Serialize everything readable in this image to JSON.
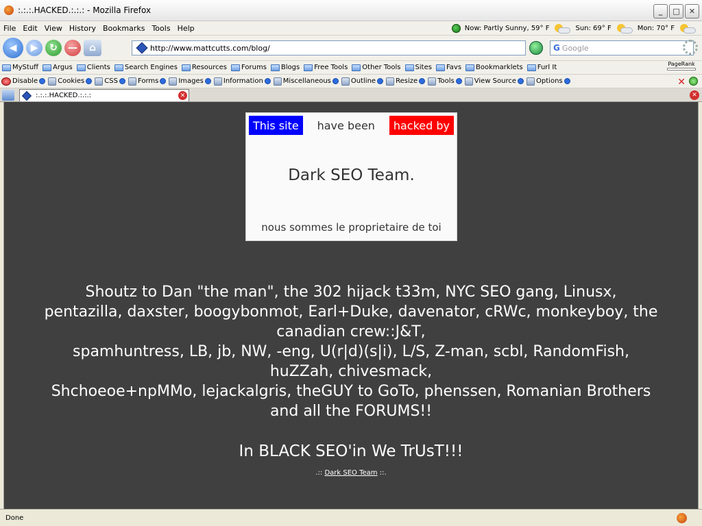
{
  "window": {
    "title": ":.:.:.HACKED.:.:.: - Mozilla Firefox"
  },
  "menu": [
    "File",
    "Edit",
    "View",
    "History",
    "Bookmarks",
    "Tools",
    "Help"
  ],
  "weather": {
    "now": "Now: Partly Sunny, 59° F",
    "sun": "Sun: 69° F",
    "mon": "Mon: 70° F"
  },
  "nav": {
    "url": "http://www.mattcutts.com/blog/",
    "search_placeholder": "Google"
  },
  "bookmarks": [
    "MyStuff",
    "Argus",
    "Clients",
    "Search Engines",
    "Resources",
    "Forums",
    "Blogs",
    "Free Tools",
    "Other Tools",
    "Sites",
    "Favs",
    "Bookmarklets",
    "Furl It"
  ],
  "pagerank_label": "PageRank",
  "devtools": [
    "Disable",
    "Cookies",
    "CSS",
    "Forms",
    "Images",
    "Information",
    "Miscellaneous",
    "Outline",
    "Resize",
    "Tools",
    "View Source",
    "Options"
  ],
  "tab": {
    "title": ":.:.:.HACKED.:.:.:"
  },
  "page": {
    "this_site": "This site",
    "have_been": "have been",
    "hacked_by": "hacked by",
    "team": "Dark SEO Team.",
    "nous": "nous sommes le proprietaire de toi",
    "shout_lines": [
      "Shoutz to Dan \"the man\", the 302 hijack t33m, NYC SEO gang, Linusx,",
      "pentazilla, daxster, boogybonmot, Earl+Duke, davenator, cRWc, monkeyboy, the",
      "canadian crew::J&T,",
      "spamhuntress, LB, jb, NW, -eng, U(r|d)(s|i), L/S, Z-man, scbl, RandomFish,",
      "huZZah, chivesmack,",
      "Shchoeoe+npMMo, lejackalgris, theGUY to GoTo, phenssen, Romanian Brothers",
      "and all the FORUMS!!"
    ],
    "trust": "In BLACK SEO'in We TrUsT!!!",
    "foot_prefix": ".:: ",
    "foot_link": "Dark SEO Team",
    "foot_suffix": " ::."
  },
  "status": "Done"
}
